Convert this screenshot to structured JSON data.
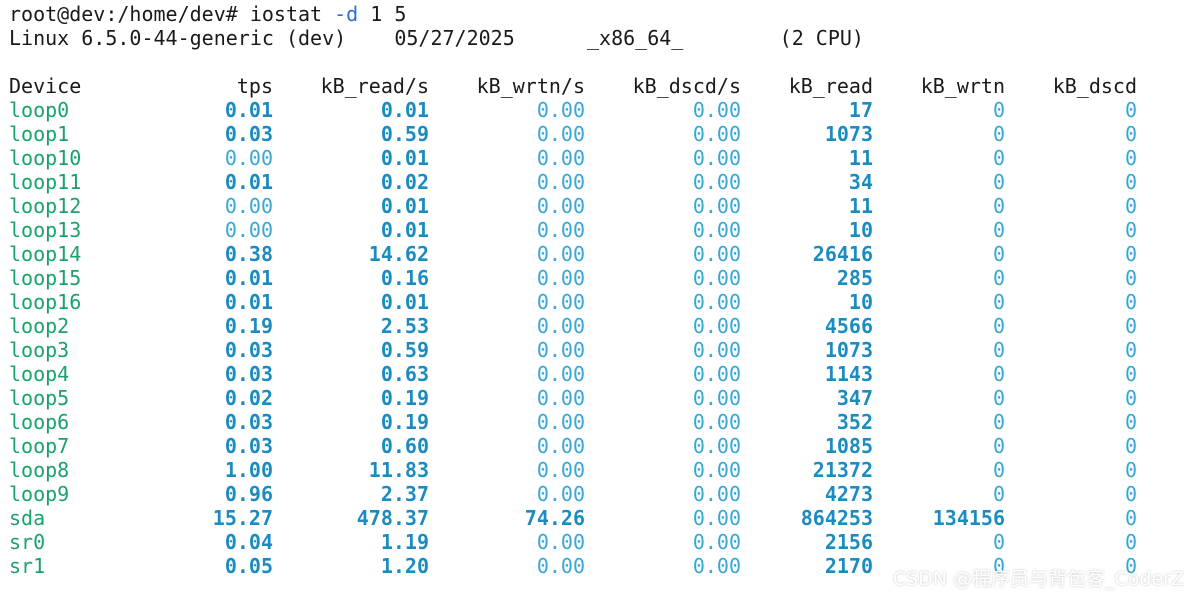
{
  "terminal": {
    "prompt": "root@dev:/home/dev#",
    "command": "iostat",
    "flag": "-d",
    "args": "1 5",
    "sysinfo": {
      "kernel": "Linux 6.5.0-44-generic",
      "host": "(dev)",
      "date": "05/27/2025",
      "arch": "_x86_64_",
      "cpus": "(2 CPU)"
    }
  },
  "table": {
    "headers": [
      "Device",
      "tps",
      "kB_read/s",
      "kB_wrtn/s",
      "kB_dscd/s",
      "kB_read",
      "kB_wrtn",
      "kB_dscd"
    ],
    "rows": [
      {
        "device": "loop0",
        "tps": "0.01",
        "kB_read_s": "0.01",
        "kB_wrtn_s": "0.00",
        "kB_dscd_s": "0.00",
        "kB_read": "17",
        "kB_wrtn": "0",
        "kB_dscd": "0"
      },
      {
        "device": "loop1",
        "tps": "0.03",
        "kB_read_s": "0.59",
        "kB_wrtn_s": "0.00",
        "kB_dscd_s": "0.00",
        "kB_read": "1073",
        "kB_wrtn": "0",
        "kB_dscd": "0"
      },
      {
        "device": "loop10",
        "tps": "0.00",
        "kB_read_s": "0.01",
        "kB_wrtn_s": "0.00",
        "kB_dscd_s": "0.00",
        "kB_read": "11",
        "kB_wrtn": "0",
        "kB_dscd": "0"
      },
      {
        "device": "loop11",
        "tps": "0.01",
        "kB_read_s": "0.02",
        "kB_wrtn_s": "0.00",
        "kB_dscd_s": "0.00",
        "kB_read": "34",
        "kB_wrtn": "0",
        "kB_dscd": "0"
      },
      {
        "device": "loop12",
        "tps": "0.00",
        "kB_read_s": "0.01",
        "kB_wrtn_s": "0.00",
        "kB_dscd_s": "0.00",
        "kB_read": "11",
        "kB_wrtn": "0",
        "kB_dscd": "0"
      },
      {
        "device": "loop13",
        "tps": "0.00",
        "kB_read_s": "0.01",
        "kB_wrtn_s": "0.00",
        "kB_dscd_s": "0.00",
        "kB_read": "10",
        "kB_wrtn": "0",
        "kB_dscd": "0"
      },
      {
        "device": "loop14",
        "tps": "0.38",
        "kB_read_s": "14.62",
        "kB_wrtn_s": "0.00",
        "kB_dscd_s": "0.00",
        "kB_read": "26416",
        "kB_wrtn": "0",
        "kB_dscd": "0"
      },
      {
        "device": "loop15",
        "tps": "0.01",
        "kB_read_s": "0.16",
        "kB_wrtn_s": "0.00",
        "kB_dscd_s": "0.00",
        "kB_read": "285",
        "kB_wrtn": "0",
        "kB_dscd": "0"
      },
      {
        "device": "loop16",
        "tps": "0.01",
        "kB_read_s": "0.01",
        "kB_wrtn_s": "0.00",
        "kB_dscd_s": "0.00",
        "kB_read": "10",
        "kB_wrtn": "0",
        "kB_dscd": "0"
      },
      {
        "device": "loop2",
        "tps": "0.19",
        "kB_read_s": "2.53",
        "kB_wrtn_s": "0.00",
        "kB_dscd_s": "0.00",
        "kB_read": "4566",
        "kB_wrtn": "0",
        "kB_dscd": "0"
      },
      {
        "device": "loop3",
        "tps": "0.03",
        "kB_read_s": "0.59",
        "kB_wrtn_s": "0.00",
        "kB_dscd_s": "0.00",
        "kB_read": "1073",
        "kB_wrtn": "0",
        "kB_dscd": "0"
      },
      {
        "device": "loop4",
        "tps": "0.03",
        "kB_read_s": "0.63",
        "kB_wrtn_s": "0.00",
        "kB_dscd_s": "0.00",
        "kB_read": "1143",
        "kB_wrtn": "0",
        "kB_dscd": "0"
      },
      {
        "device": "loop5",
        "tps": "0.02",
        "kB_read_s": "0.19",
        "kB_wrtn_s": "0.00",
        "kB_dscd_s": "0.00",
        "kB_read": "347",
        "kB_wrtn": "0",
        "kB_dscd": "0"
      },
      {
        "device": "loop6",
        "tps": "0.03",
        "kB_read_s": "0.19",
        "kB_wrtn_s": "0.00",
        "kB_dscd_s": "0.00",
        "kB_read": "352",
        "kB_wrtn": "0",
        "kB_dscd": "0"
      },
      {
        "device": "loop7",
        "tps": "0.03",
        "kB_read_s": "0.60",
        "kB_wrtn_s": "0.00",
        "kB_dscd_s": "0.00",
        "kB_read": "1085",
        "kB_wrtn": "0",
        "kB_dscd": "0"
      },
      {
        "device": "loop8",
        "tps": "1.00",
        "kB_read_s": "11.83",
        "kB_wrtn_s": "0.00",
        "kB_dscd_s": "0.00",
        "kB_read": "21372",
        "kB_wrtn": "0",
        "kB_dscd": "0"
      },
      {
        "device": "loop9",
        "tps": "0.96",
        "kB_read_s": "2.37",
        "kB_wrtn_s": "0.00",
        "kB_dscd_s": "0.00",
        "kB_read": "4273",
        "kB_wrtn": "0",
        "kB_dscd": "0"
      },
      {
        "device": "sda",
        "tps": "15.27",
        "kB_read_s": "478.37",
        "kB_wrtn_s": "74.26",
        "kB_dscd_s": "0.00",
        "kB_read": "864253",
        "kB_wrtn": "134156",
        "kB_dscd": "0"
      },
      {
        "device": "sr0",
        "tps": "0.04",
        "kB_read_s": "1.19",
        "kB_wrtn_s": "0.00",
        "kB_dscd_s": "0.00",
        "kB_read": "2156",
        "kB_wrtn": "0",
        "kB_dscd": "0"
      },
      {
        "device": "sr1",
        "tps": "0.05",
        "kB_read_s": "1.20",
        "kB_wrtn_s": "0.00",
        "kB_dscd_s": "0.00",
        "kB_read": "2170",
        "kB_wrtn": "0",
        "kB_dscd": "0"
      }
    ]
  },
  "watermark": "CSDN @程序员与背包客_CoderZ",
  "colors": {
    "background": "#ffffff",
    "text": "#1a1a1a",
    "device": "#1aa26b",
    "number": "#1c8cc0",
    "flag": "#2b6fd6"
  }
}
